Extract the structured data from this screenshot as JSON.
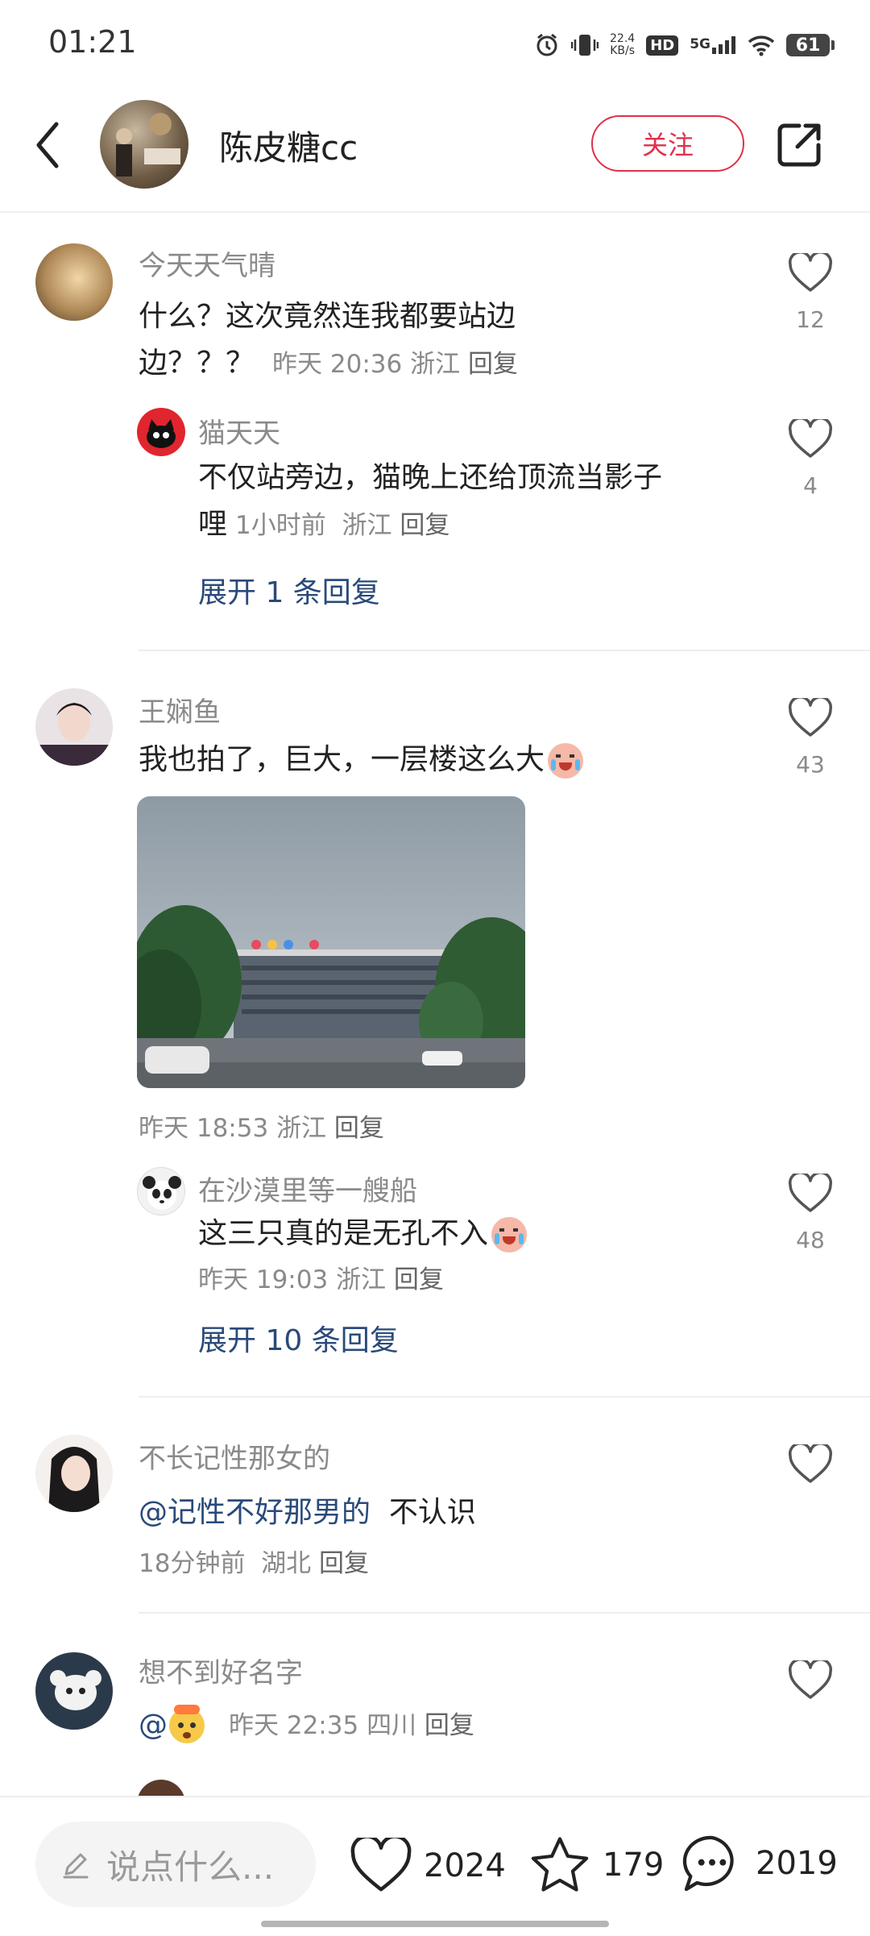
{
  "status_bar": {
    "time": "01:21",
    "net_speed_value": "22.4",
    "net_speed_unit": "KB/s",
    "hd": "HD",
    "network": "5G",
    "battery": "61"
  },
  "header": {
    "author_name": "陈皮糖cc",
    "follow_label": "关注"
  },
  "comments": [
    {
      "user": "今天天气晴",
      "text_line1": "什么？这次竟然连我都要站边",
      "text_line2": "边？？？",
      "time": "昨天 20:36",
      "location": "浙江",
      "reply": "回复",
      "likes": "12",
      "subreply": {
        "user": "猫天天",
        "text_line1": "不仅站旁边，猫晚上还给顶流当影子",
        "text_line2": "哩",
        "time": "1小时前",
        "location": "浙江",
        "reply": "回复",
        "likes": "4"
      },
      "expand": "展开 1 条回复"
    },
    {
      "user": "王娴鱼",
      "text": "我也拍了，巨大，一层楼这么大",
      "time": "昨天 18:53",
      "location": "浙江",
      "reply": "回复",
      "likes": "43",
      "subreply": {
        "user": "在沙漠里等一艘船",
        "text": "这三只真的是无孔不入",
        "time": "昨天 19:03",
        "location": "浙江",
        "reply": "回复",
        "likes": "48"
      },
      "expand": "展开 10 条回复"
    },
    {
      "user": "不长记性那女的",
      "mention": "@记性不好那男的",
      "text": "不认识",
      "time": "18分钟前",
      "location": "湖北",
      "reply": "回复"
    },
    {
      "user": "想不到好名字",
      "mention": "@",
      "time": "昨天 22:35",
      "location": "四川",
      "reply": "回复"
    }
  ],
  "bottom_bar": {
    "input_placeholder": "说点什么...",
    "likes": "2024",
    "stars": "179",
    "comments": "2019"
  },
  "colors": {
    "accent_red": "#e0314a",
    "link_blue": "#2a4a7a",
    "meta_gray": "#8a8a8a"
  }
}
